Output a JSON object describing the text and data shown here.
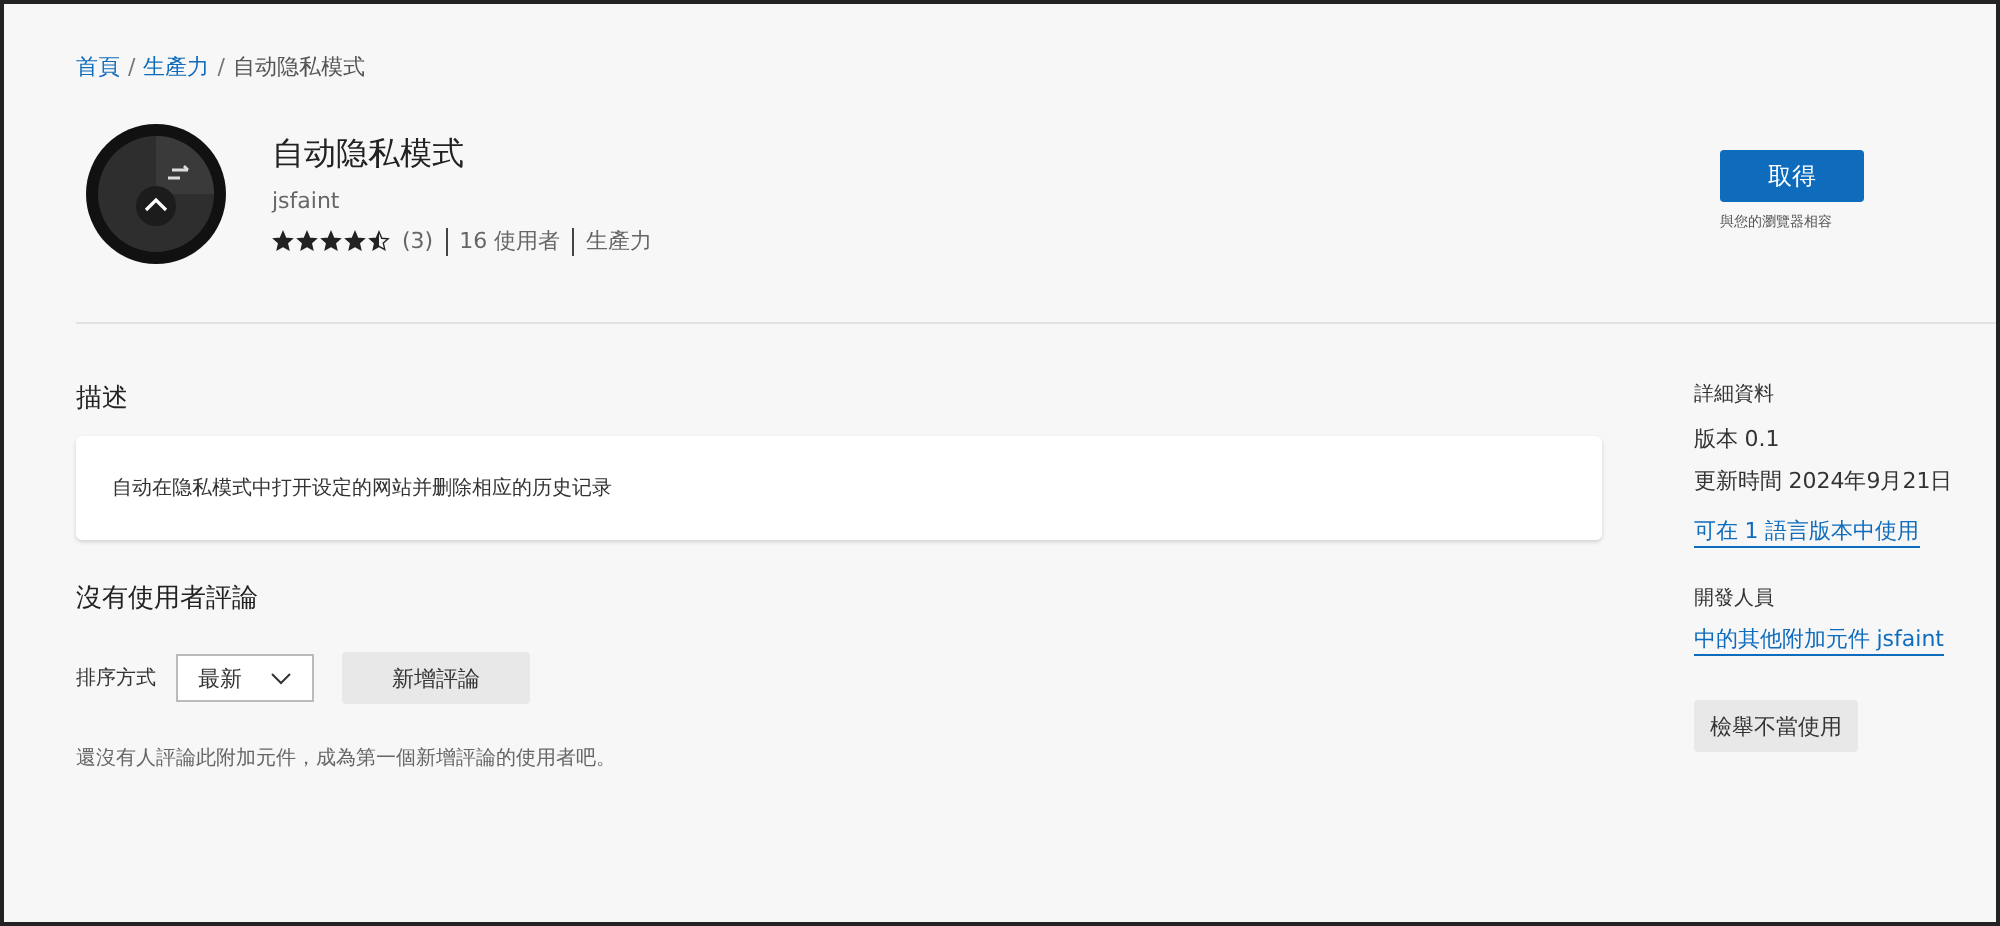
{
  "breadcrumb_separator": "/",
  "breadcrumb": [
    {
      "label": "首頁",
      "kind": "link"
    },
    {
      "label": "生產力",
      "kind": "link"
    },
    {
      "label": "自动隐私模式",
      "kind": "current"
    }
  ],
  "addon": {
    "title": "自动隐私模式",
    "author": "jsfaint",
    "stars": 4.5,
    "rating_count": "(3)",
    "users": "16 使用者",
    "category": "生產力"
  },
  "get_button": {
    "label": "取得",
    "note": "與您的瀏覽器相容"
  },
  "description": {
    "heading": "描述",
    "text": "自动在隐私模式中打开设定的网站并删除相应的历史记录"
  },
  "reviews": {
    "heading": "沒有使用者評論",
    "sort_label": "排序方式",
    "sort_value": "最新",
    "add_button": "新增評論",
    "empty_text": "還沒有人評論此附加元件，成為第一個新增評論的使用者吧。"
  },
  "details": {
    "heading": "詳細資料",
    "version": "版本 0.1",
    "updated": "更新時間 2024年9月21日",
    "languages_link": "可在 1 語言版本中使用",
    "developer_heading": "開發人員",
    "developer_link": "中的其他附加元件 jsfaint",
    "report_button": "檢舉不當使用"
  }
}
